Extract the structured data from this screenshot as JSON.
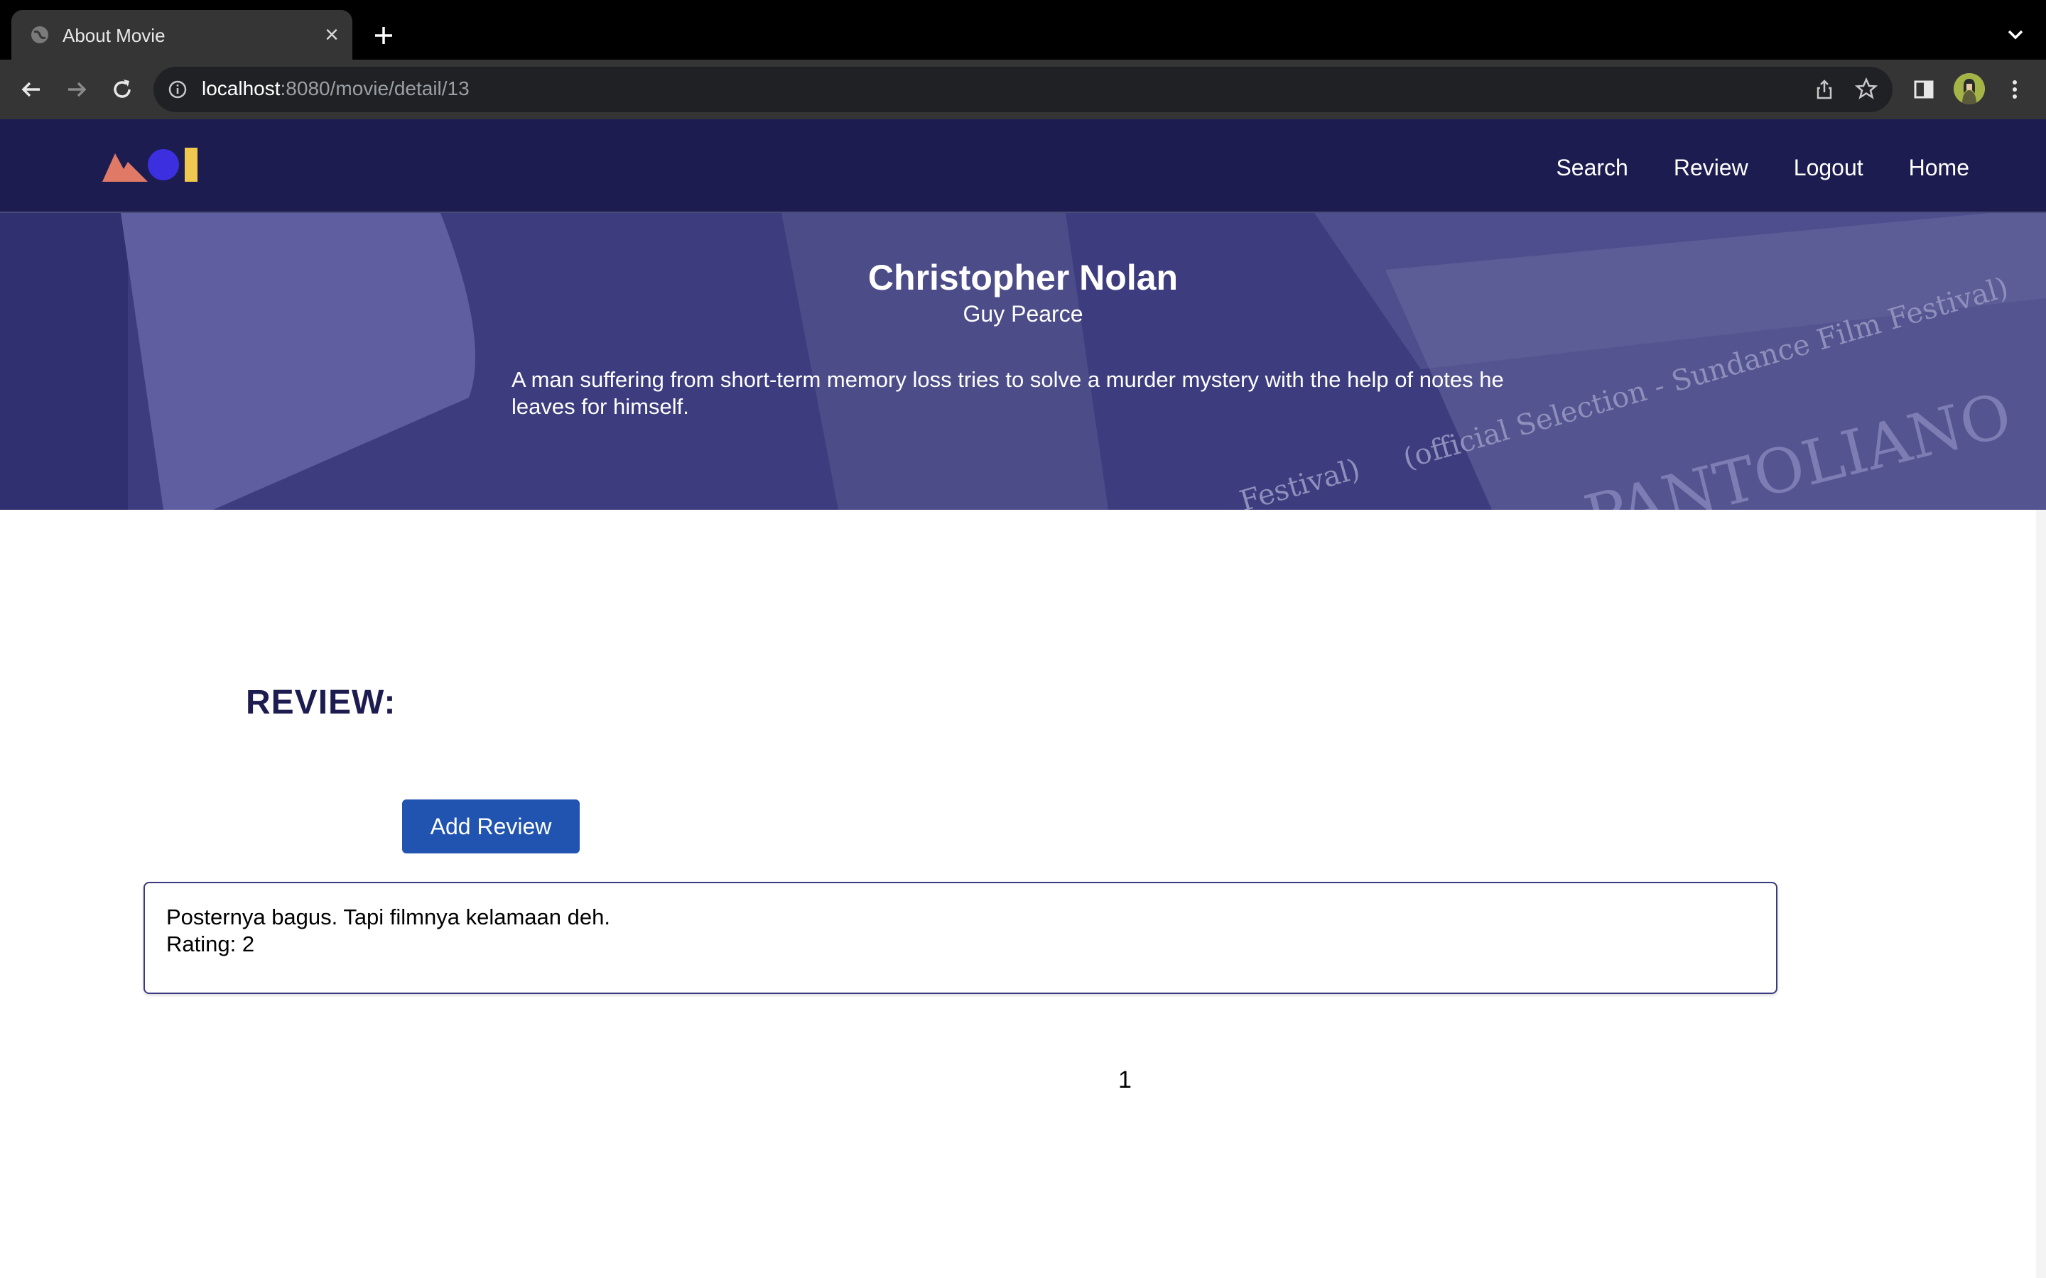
{
  "browser": {
    "tab_title": "About Movie",
    "url_host": "localhost",
    "url_path": ":8080/movie/detail/13"
  },
  "nav": {
    "links": [
      "Search",
      "Review",
      "Logout",
      "Home"
    ]
  },
  "logo": {
    "colors": {
      "triangle": "#e07a66",
      "circle": "#3b2fe0",
      "bar": "#f0c850"
    }
  },
  "movie": {
    "director": "Christopher Nolan",
    "actor": "Guy Pearce",
    "synopsis": "A man suffering from short-term memory loss tries to solve a murder mystery with the help of notes he leaves for himself.",
    "background_text": [
      "(official Selection - Sundance Film Festival)",
      "Festival)",
      "PANTOLIANO"
    ]
  },
  "reviews": {
    "heading": "REVIEW:",
    "add_button": "Add Review",
    "items": [
      {
        "text": "Posternya bagus. Tapi filmnya kelamaan deh.",
        "rating_label": "Rating: 2"
      }
    ],
    "pagination": "1"
  },
  "colors": {
    "navbar_bg": "#1c1c50",
    "hero_tint": "#45458a",
    "button_bg": "#2153b0",
    "heading": "#1c1c50"
  }
}
